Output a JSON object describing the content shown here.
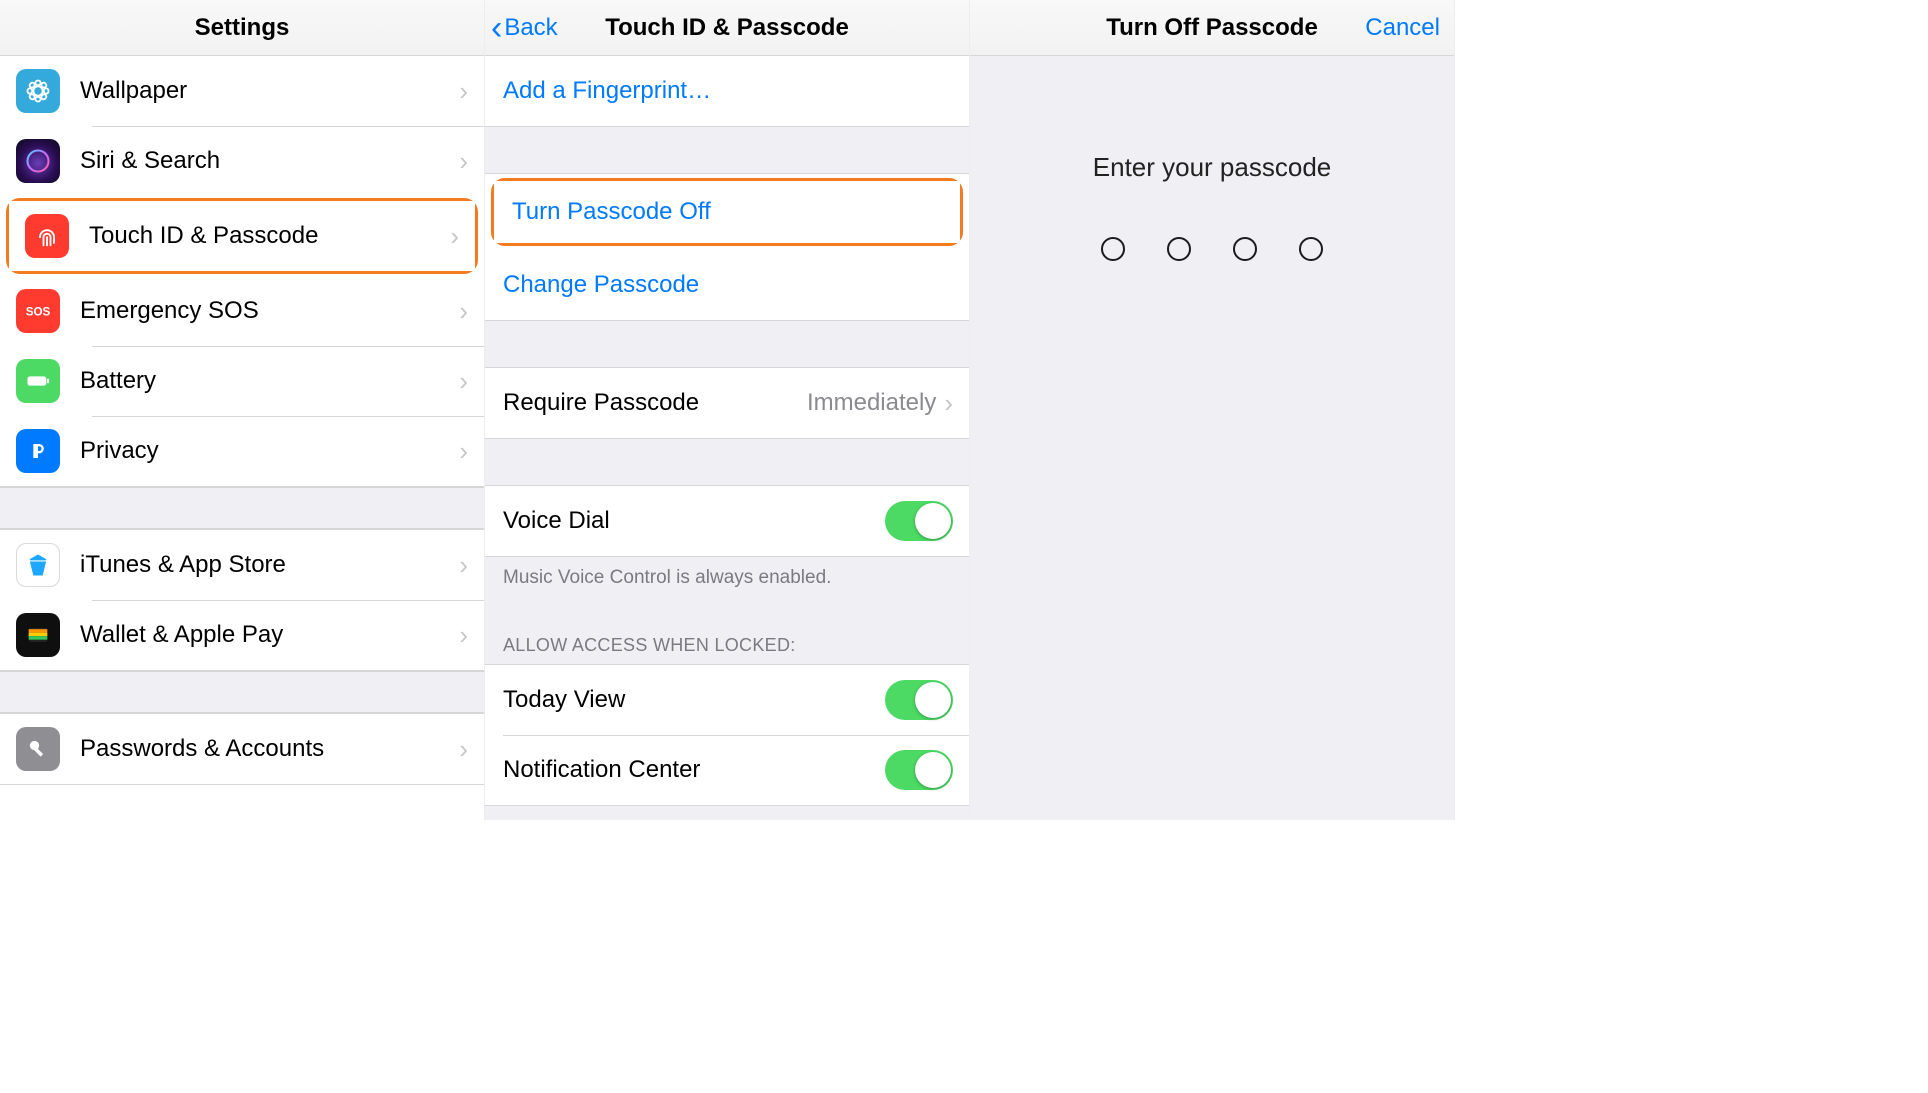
{
  "pane1": {
    "title": "Settings",
    "groups": [
      [
        {
          "id": "wallpaper",
          "label": "Wallpaper",
          "iconBg": "bg-cyan"
        },
        {
          "id": "siri",
          "label": "Siri & Search",
          "iconBg": "bg-siri"
        },
        {
          "id": "touchid",
          "label": "Touch ID & Passcode",
          "iconBg": "bg-red",
          "highlight": true
        },
        {
          "id": "sos",
          "label": "Emergency SOS",
          "iconBg": "bg-red"
        },
        {
          "id": "battery",
          "label": "Battery",
          "iconBg": "bg-green"
        },
        {
          "id": "privacy",
          "label": "Privacy",
          "iconBg": "bg-blue"
        }
      ],
      [
        {
          "id": "itunes",
          "label": "iTunes & App Store",
          "iconBg": "bg-white"
        },
        {
          "id": "wallet",
          "label": "Wallet & Apple Pay",
          "iconBg": "bg-black"
        }
      ],
      [
        {
          "id": "passwords",
          "label": "Passwords & Accounts",
          "iconBg": "bg-grey"
        }
      ]
    ]
  },
  "pane2": {
    "back": "Back",
    "title": "Touch ID & Passcode",
    "addFingerprint": "Add a Fingerprint…",
    "turnOff": "Turn Passcode Off",
    "changePasscode": "Change Passcode",
    "require": {
      "label": "Require Passcode",
      "value": "Immediately"
    },
    "voiceDial": "Voice Dial",
    "voiceFooter": "Music Voice Control is always enabled.",
    "allowHeader": "ALLOW ACCESS WHEN LOCKED:",
    "today": "Today View",
    "notif": "Notification Center"
  },
  "pane3": {
    "title": "Turn Off Passcode",
    "cancel": "Cancel",
    "prompt": "Enter your passcode",
    "dots": 4
  }
}
